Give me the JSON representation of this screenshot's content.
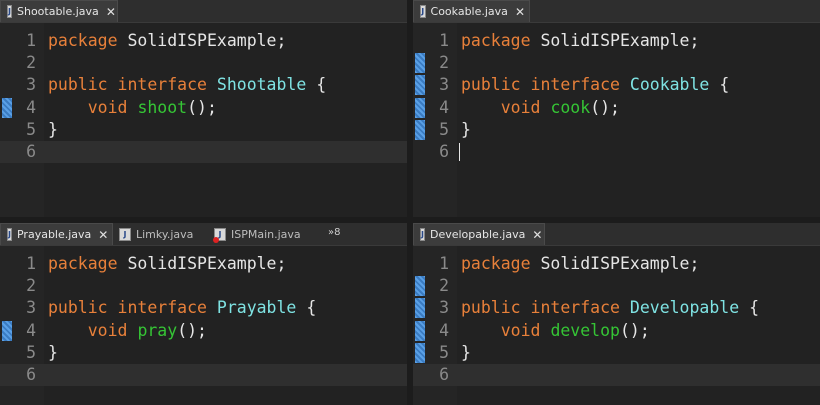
{
  "panes": [
    {
      "tabs": [
        {
          "label": "Shootable.java",
          "active": true,
          "close": "✕"
        }
      ],
      "package_kw": "package",
      "package_name": "SolidISPExample;",
      "public_kw": "public",
      "interface_kw": "interface",
      "type_name": "Shootable",
      "brace_open": "{",
      "void_kw": "void",
      "method_name": "shoot",
      "method_tail": "();",
      "brace_close": "}",
      "line_numbers": [
        "1",
        "2",
        "3",
        "4",
        "5",
        "6"
      ]
    },
    {
      "tabs": [
        {
          "label": "Cookable.java",
          "active": true,
          "close": "✕"
        }
      ],
      "package_kw": "package",
      "package_name": "SolidISPExample;",
      "public_kw": "public",
      "interface_kw": "interface",
      "type_name": "Cookable",
      "brace_open": "{",
      "void_kw": "void",
      "method_name": "cook",
      "method_tail": "();",
      "brace_close": "}",
      "line_numbers": [
        "1",
        "2",
        "3",
        "4",
        "5",
        "6"
      ]
    },
    {
      "tabs": [
        {
          "label": "Prayable.java",
          "active": true,
          "close": "✕"
        },
        {
          "label": "Limky.java",
          "active": false
        },
        {
          "label": "ISPMain.java",
          "active": false,
          "error": true
        }
      ],
      "overflow": "»8",
      "package_kw": "package",
      "package_name": "SolidISPExample;",
      "public_kw": "public",
      "interface_kw": "interface",
      "type_name": "Prayable",
      "brace_open": "{",
      "void_kw": "void",
      "method_name": "pray",
      "method_tail": "();",
      "brace_close": "}",
      "line_numbers": [
        "1",
        "2",
        "3",
        "4",
        "5",
        "6"
      ]
    },
    {
      "tabs": [
        {
          "label": "Developable.java",
          "active": true,
          "close": "✕"
        }
      ],
      "package_kw": "package",
      "package_name": "SolidISPExample;",
      "public_kw": "public",
      "interface_kw": "interface",
      "type_name": "Developable",
      "brace_open": "{",
      "void_kw": "void",
      "method_name": "develop",
      "method_tail": "();",
      "brace_close": "}",
      "line_numbers": [
        "1",
        "2",
        "3",
        "4",
        "5",
        "6"
      ]
    }
  ],
  "colors": {
    "keyword": "#e8803a",
    "type": "#7fe3e3",
    "method": "#35c535",
    "marker": "#5aa0e6"
  }
}
